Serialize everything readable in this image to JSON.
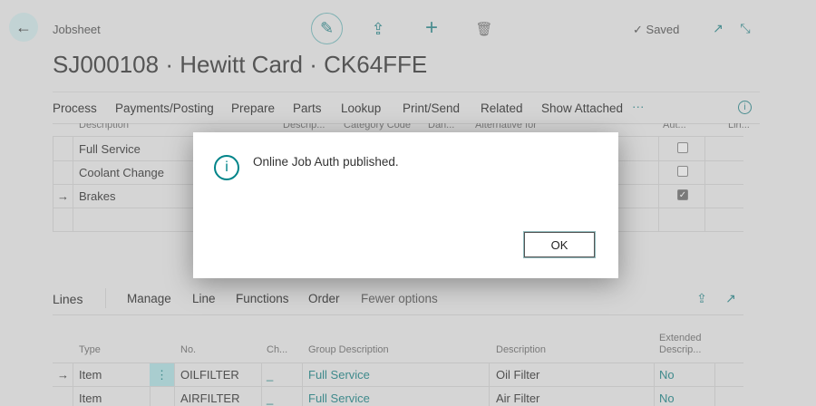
{
  "header": {
    "breadcrumb": "Jobsheet",
    "title": "SJ000108 · Hewitt Card · CK64FFE",
    "saved": "Saved"
  },
  "icons": {
    "back": "←",
    "edit": "✎",
    "share": "⇪",
    "add": "+",
    "delete": "🗑",
    "check": "✓",
    "open_new": "↗",
    "collapse": "⤡",
    "info": "i",
    "more": "···",
    "row_arrow": "→",
    "kebab": "⋮"
  },
  "menu": [
    "Process",
    "Payments/Posting",
    "Prepare",
    "Parts",
    "Lookup",
    "Print/Send",
    "Related",
    "Show Attached"
  ],
  "groups": {
    "headers": [
      "Description",
      "Descrip...",
      "Category Code",
      "Dan...",
      "Alternative for",
      "Aut...",
      "Lin..."
    ],
    "rows": [
      {
        "description": "Full Service",
        "auth": false
      },
      {
        "description": "Coolant Change",
        "auth": false
      },
      {
        "description": "Brakes",
        "auth": true
      }
    ]
  },
  "lines": {
    "title": "Lines",
    "menu": [
      "Manage",
      "Line",
      "Functions",
      "Order",
      "Fewer options"
    ],
    "headers": {
      "type": "Type",
      "no": "No.",
      "ch": "Ch...",
      "group": "Group Description",
      "description": "Description",
      "ext1": "Extended",
      "ext2": "Descrip..."
    },
    "rows": [
      {
        "type": "Item",
        "no": "OILFILTER",
        "ch": "_",
        "group": "Full Service",
        "description": "Oil Filter",
        "ext": "No"
      },
      {
        "type": "Item",
        "no": "AIRFILTER",
        "ch": "_",
        "group": "Full Service",
        "description": "Air Filter",
        "ext": "No"
      }
    ]
  },
  "dialog": {
    "message": "Online Job Auth published.",
    "ok": "OK"
  },
  "colors": {
    "accent": "#008489",
    "background_dim": "#d5d5d5"
  }
}
